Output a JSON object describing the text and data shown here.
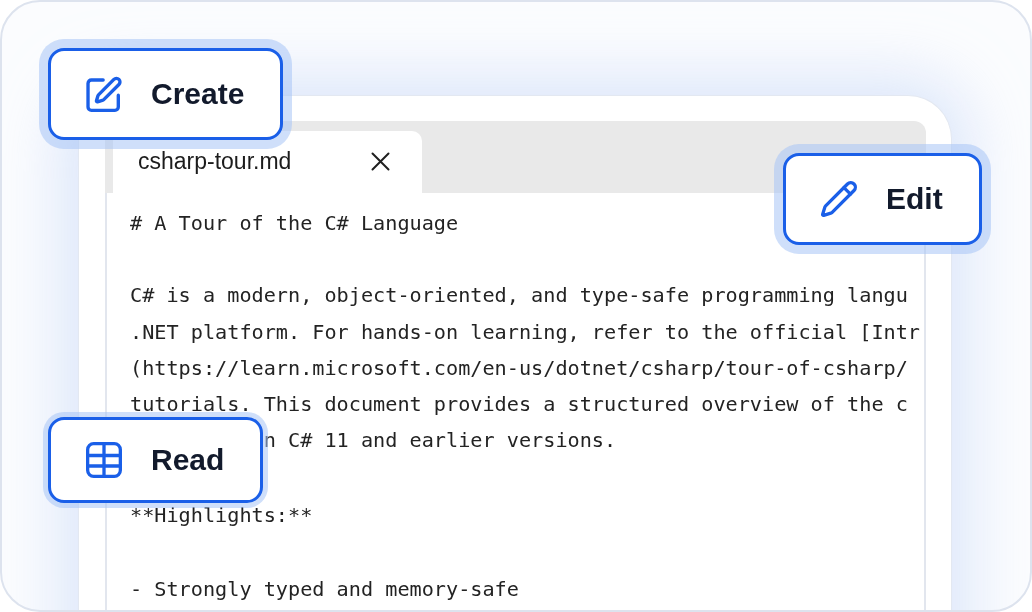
{
  "actions": [
    {
      "label": "Create",
      "kind": "create"
    },
    {
      "label": "Edit",
      "kind": "edit"
    },
    {
      "label": "Read",
      "kind": "read"
    }
  ],
  "tabs": [
    {
      "label": "csharp-tour.md",
      "selected": true
    }
  ],
  "blocks": [
    {
      "lines": [
        {
          "text": "# A Tour of the C# Language",
          "covered": false
        }
      ]
    },
    {
      "lines": [
        {
          "text": "C# is a modern, object-oriented, and type-safe programming langu",
          "covered": false
        },
        {
          "text": ".NET platform. For hands-on learning, refer to the official [Intr",
          "covered": false
        },
        {
          "text": "(https://learn.microsoft.com/en-us/dotnet/csharp/tour-of-csharp/",
          "covered": false
        },
        {
          "text": "tutorials. This document provides a structured overview of the c",
          "covered": false
        },
        {
          "text": "n C# 11 and earlier versions.",
          "covered": true
        }
      ]
    },
    {
      "lines": [
        {
          "text": "**Highlights:**",
          "covered": false
        }
      ]
    },
    {
      "lines": [
        {
          "text": "- Strongly typed and memory-safe",
          "covered": false
        }
      ]
    }
  ]
}
